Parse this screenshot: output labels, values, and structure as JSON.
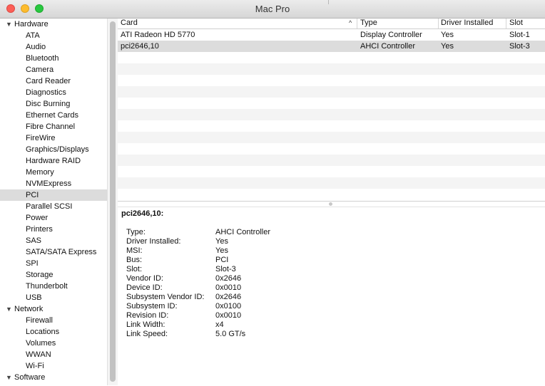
{
  "window": {
    "title": "Mac Pro"
  },
  "sidebar": {
    "groups": [
      {
        "label": "Hardware",
        "items": [
          "ATA",
          "Audio",
          "Bluetooth",
          "Camera",
          "Card Reader",
          "Diagnostics",
          "Disc Burning",
          "Ethernet Cards",
          "Fibre Channel",
          "FireWire",
          "Graphics/Displays",
          "Hardware RAID",
          "Memory",
          "NVMExpress",
          "PCI",
          "Parallel SCSI",
          "Power",
          "Printers",
          "SAS",
          "SATA/SATA Express",
          "SPI",
          "Storage",
          "Thunderbolt",
          "USB"
        ]
      },
      {
        "label": "Network",
        "items": [
          "Firewall",
          "Locations",
          "Volumes",
          "WWAN",
          "Wi-Fi"
        ]
      },
      {
        "label": "Software",
        "items": []
      }
    ],
    "selected_item": "PCI"
  },
  "table": {
    "columns": [
      "Card",
      "Type",
      "Driver Installed",
      "Slot"
    ],
    "rows": [
      [
        "ATI Radeon HD 5770",
        "Display Controller",
        "Yes",
        "Slot-1"
      ],
      [
        "pci2646,10",
        "AHCI Controller",
        "Yes",
        "Slot-3"
      ]
    ],
    "selected_row": 1
  },
  "detail": {
    "title": "pci2646,10:",
    "properties": [
      {
        "key": "Type:",
        "value": "AHCI Controller"
      },
      {
        "key": "Driver Installed:",
        "value": "Yes"
      },
      {
        "key": "MSI:",
        "value": "Yes"
      },
      {
        "key": "Bus:",
        "value": "PCI"
      },
      {
        "key": "Slot:",
        "value": "Slot-3"
      },
      {
        "key": "Vendor ID:",
        "value": "0x2646"
      },
      {
        "key": "Device ID:",
        "value": "0x0010"
      },
      {
        "key": "Subsystem Vendor ID:",
        "value": "0x2646"
      },
      {
        "key": "Subsystem ID:",
        "value": "0x0100"
      },
      {
        "key": "Revision ID:",
        "value": "0x0010"
      },
      {
        "key": "Link Width:",
        "value": "x4"
      },
      {
        "key": "Link Speed:",
        "value": "5.0 GT/s"
      }
    ]
  },
  "colors": {
    "selection": "#dcdcdc",
    "stripe": "#f4f4f4"
  }
}
